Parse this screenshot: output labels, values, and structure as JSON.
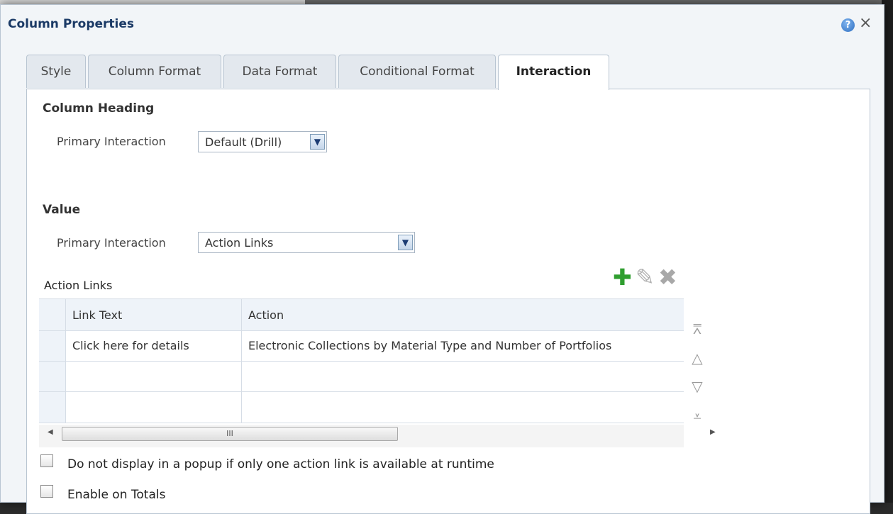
{
  "dialog": {
    "title": "Column Properties",
    "help_icon": "?",
    "close_icon": "×"
  },
  "tabs": [
    {
      "label": "Style"
    },
    {
      "label": "Column Format"
    },
    {
      "label": "Data Format"
    },
    {
      "label": "Conditional Format"
    },
    {
      "label": "Interaction",
      "active": true
    }
  ],
  "column_heading": {
    "title": "Column Heading",
    "primary_label": "Primary Interaction",
    "primary_value": "Default (Drill)"
  },
  "value": {
    "title": "Value",
    "primary_label": "Primary Interaction",
    "primary_value": "Action Links"
  },
  "action_links": {
    "label": "Action Links",
    "toolbar": {
      "add_icon": "plus-icon",
      "edit_icon": "pencil-icon",
      "delete_icon": "x-icon"
    },
    "columns": [
      "Link Text",
      "Action"
    ],
    "rows": [
      [
        "Click here for details",
        "Electronic Collections by Material Type and Number of Portfolios"
      ],
      [
        "",
        ""
      ],
      [
        "",
        ""
      ]
    ],
    "scroll_thumb": "III"
  },
  "options": {
    "no_popup_label": "Do not display in a popup if only one action link is available at runtime",
    "enable_totals_label": "Enable on Totals"
  },
  "colors": {
    "title": "#1b3a66",
    "border": "#b9c5d2",
    "add_green": "#2f9e2f"
  }
}
